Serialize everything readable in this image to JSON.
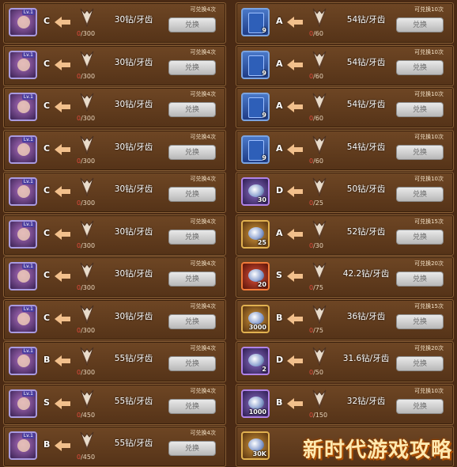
{
  "left": [
    {
      "grade": "C",
      "price": "30钻/牙齿",
      "current": "0",
      "total": "/300",
      "limit": "可兑换4次",
      "button": "兑换",
      "icon": "hero-portrait-icon",
      "count": ""
    },
    {
      "grade": "C",
      "price": "30钻/牙齿",
      "current": "0",
      "total": "/300",
      "limit": "可兑换4次",
      "button": "兑换",
      "icon": "hero-portrait-icon",
      "count": ""
    },
    {
      "grade": "C",
      "price": "30钻/牙齿",
      "current": "0",
      "total": "/300",
      "limit": "可兑换4次",
      "button": "兑换",
      "icon": "hero-portrait-icon",
      "count": ""
    },
    {
      "grade": "C",
      "price": "30钻/牙齿",
      "current": "0",
      "total": "/300",
      "limit": "可兑换4次",
      "button": "兑换",
      "icon": "hero-portrait-icon",
      "count": ""
    },
    {
      "grade": "C",
      "price": "30钻/牙齿",
      "current": "0",
      "total": "/300",
      "limit": "可兑换4次",
      "button": "兑换",
      "icon": "hero-portrait-icon",
      "count": ""
    },
    {
      "grade": "C",
      "price": "30钻/牙齿",
      "current": "0",
      "total": "/300",
      "limit": "可兑换4次",
      "button": "兑换",
      "icon": "hero-portrait-icon",
      "count": ""
    },
    {
      "grade": "C",
      "price": "30钻/牙齿",
      "current": "0",
      "total": "/300",
      "limit": "可兑换4次",
      "button": "兑换",
      "icon": "hero-portrait-icon",
      "count": ""
    },
    {
      "grade": "C",
      "price": "30钻/牙齿",
      "current": "0",
      "total": "/300",
      "limit": "可兑换4次",
      "button": "兑换",
      "icon": "hero-portrait-icon",
      "count": ""
    },
    {
      "grade": "B",
      "price": "55钻/牙齿",
      "current": "0",
      "total": "/300",
      "limit": "可兑换4次",
      "button": "兑换",
      "icon": "hero-portrait-icon",
      "count": ""
    },
    {
      "grade": "S",
      "price": "55钻/牙齿",
      "current": "0",
      "total": "/450",
      "limit": "可兑换4次",
      "button": "兑换",
      "icon": "hero-portrait-icon",
      "count": ""
    },
    {
      "grade": "B",
      "price": "55钻/牙齿",
      "current": "0",
      "total": "/450",
      "limit": "可兑换4次",
      "button": "兑换",
      "icon": "hero-portrait-icon",
      "count": ""
    }
  ],
  "right": [
    {
      "grade": "A",
      "price": "54钻/牙齿",
      "current": "0",
      "total": "/60",
      "limit": "可兑换10次",
      "button": "兑换",
      "icon": "card-icon",
      "count": "9"
    },
    {
      "grade": "A",
      "price": "54钻/牙齿",
      "current": "0",
      "total": "/60",
      "limit": "可兑换10次",
      "button": "兑换",
      "icon": "card-icon",
      "count": "9"
    },
    {
      "grade": "A",
      "price": "54钻/牙齿",
      "current": "0",
      "total": "/60",
      "limit": "可兑换10次",
      "button": "兑换",
      "icon": "card-icon",
      "count": "9"
    },
    {
      "grade": "A",
      "price": "54钻/牙齿",
      "current": "0",
      "total": "/60",
      "limit": "可兑换10次",
      "button": "兑换",
      "icon": "card-icon",
      "count": "9"
    },
    {
      "grade": "D",
      "price": "50钻/牙齿",
      "current": "0",
      "total": "/25",
      "limit": "可兑换10次",
      "button": "兑换",
      "icon": "gem-icon",
      "count": "30"
    },
    {
      "grade": "A",
      "price": "52钻/牙齿",
      "current": "0",
      "total": "/30",
      "limit": "可兑换15次",
      "button": "兑换",
      "icon": "gold-ring-icon",
      "count": "25"
    },
    {
      "grade": "S",
      "price": "42.2钻/牙齿",
      "current": "0",
      "total": "/75",
      "limit": "可兑换20次",
      "button": "兑换",
      "icon": "treasure-icon",
      "count": "20"
    },
    {
      "grade": "B",
      "price": "36钻/牙齿",
      "current": "0",
      "total": "/75",
      "limit": "可兑换15次",
      "button": "兑换",
      "icon": "bronze-medal-icon",
      "count": "3000"
    },
    {
      "grade": "D",
      "price": "31.6钻/牙齿",
      "current": "0",
      "total": "/50",
      "limit": "可兑换20次",
      "button": "兑换",
      "icon": "scroll-icon",
      "count": "2"
    },
    {
      "grade": "B",
      "price": "32钻/牙齿",
      "current": "0",
      "total": "/150",
      "limit": "可兑换10次",
      "button": "兑换",
      "icon": "potion-icon",
      "count": "1000"
    },
    {
      "grade": "",
      "price": "",
      "current": "",
      "total": "",
      "limit": "",
      "button": "",
      "icon": "gold-coin-icon",
      "count": "30K"
    }
  ],
  "watermark": "新时代游戏攻略",
  "level_badge": "Lv.1",
  "colors": {
    "accent": "#e24b3d",
    "panel": "#6e4624",
    "button": "#d8d8d8"
  }
}
